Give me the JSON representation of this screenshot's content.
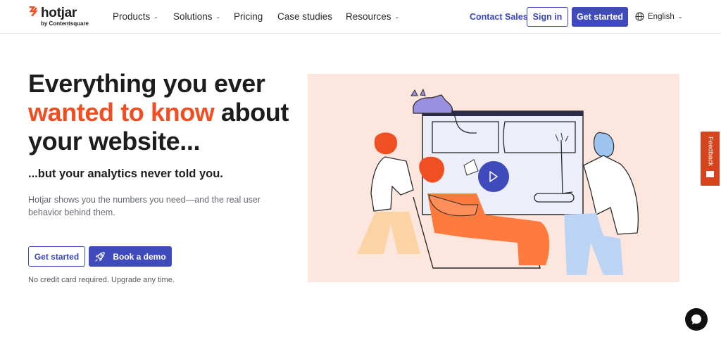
{
  "header": {
    "logo": {
      "word": "hotjar",
      "sub": "by Contentsquare"
    },
    "nav": [
      {
        "label": "Products",
        "dropdown": true
      },
      {
        "label": "Solutions",
        "dropdown": true
      },
      {
        "label": "Pricing",
        "dropdown": false
      },
      {
        "label": "Case studies",
        "dropdown": false
      },
      {
        "label": "Resources",
        "dropdown": true
      }
    ],
    "contact_sales": "Contact Sales",
    "sign_in": "Sign in",
    "get_started": "Get started",
    "language": "English"
  },
  "hero": {
    "title_line1": "Everything you ever",
    "title_accent": "wanted to know",
    "title_line2_rest": " about",
    "title_line3": "your website...",
    "subtitle": "...but your analytics never told you.",
    "description": "Hotjar shows you the numbers you need—and the real user behavior behind them.",
    "cta_primary": "Get started",
    "cta_demo": "Book a demo",
    "note": "No credit card required. Upgrade any time."
  },
  "feedback_tab": {
    "label": "Feedback"
  },
  "colors": {
    "brand_orange": "#f04e23",
    "brand_blue": "#3f4bbd",
    "illustration_bg": "#fde6dd"
  }
}
